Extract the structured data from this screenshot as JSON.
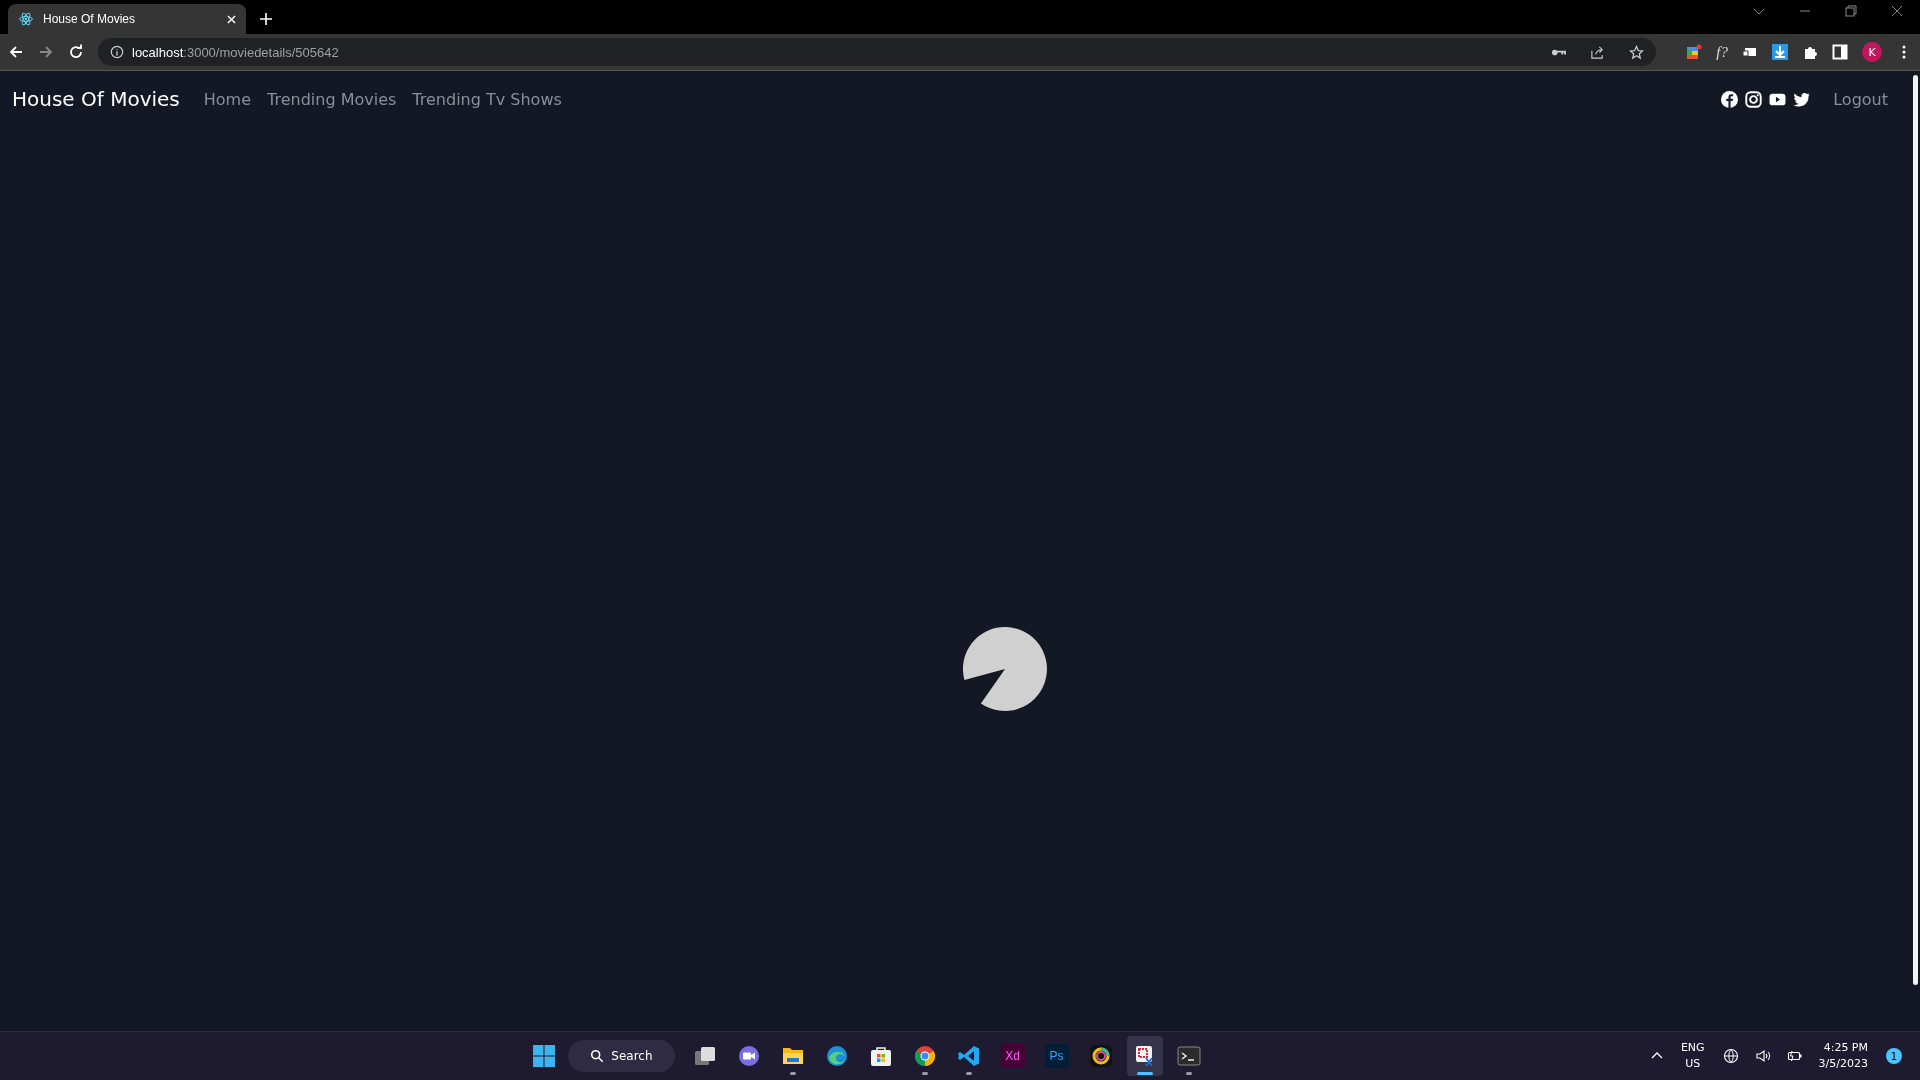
{
  "browser": {
    "tab": {
      "title": "House Of Movies"
    },
    "address": {
      "host": "localhost",
      "path": ":3000/moviedetails/505642"
    },
    "extension_label": "f?",
    "avatar": "K"
  },
  "navbar": {
    "brand": "House Of Movies",
    "links": [
      {
        "label": "Home"
      },
      {
        "label": "Trending Movies"
      },
      {
        "label": "Trending Tv Shows"
      }
    ],
    "logout": "Logout"
  },
  "taskbar": {
    "search": "Search",
    "apps": [
      {
        "kind": "taskview",
        "running": false,
        "selected": false
      },
      {
        "kind": "meet",
        "running": false,
        "selected": false
      },
      {
        "kind": "explorer",
        "running": true,
        "selected": false
      },
      {
        "kind": "edge",
        "running": false,
        "selected": false
      },
      {
        "kind": "store",
        "running": false,
        "selected": false
      },
      {
        "kind": "chrome",
        "running": true,
        "selected": false
      },
      {
        "kind": "vscode",
        "running": true,
        "selected": false
      },
      {
        "kind": "xd",
        "label": "Xd",
        "running": false,
        "selected": false
      },
      {
        "kind": "ps",
        "label": "Ps",
        "running": false,
        "selected": false
      },
      {
        "kind": "ring",
        "running": false,
        "selected": false
      },
      {
        "kind": "snip",
        "running": true,
        "selected": true
      },
      {
        "kind": "terminal",
        "running": true,
        "selected": false
      }
    ],
    "language": "ENG",
    "region": "US",
    "time": "4:25 PM",
    "date": "3/5/2023",
    "notifications": "1"
  }
}
